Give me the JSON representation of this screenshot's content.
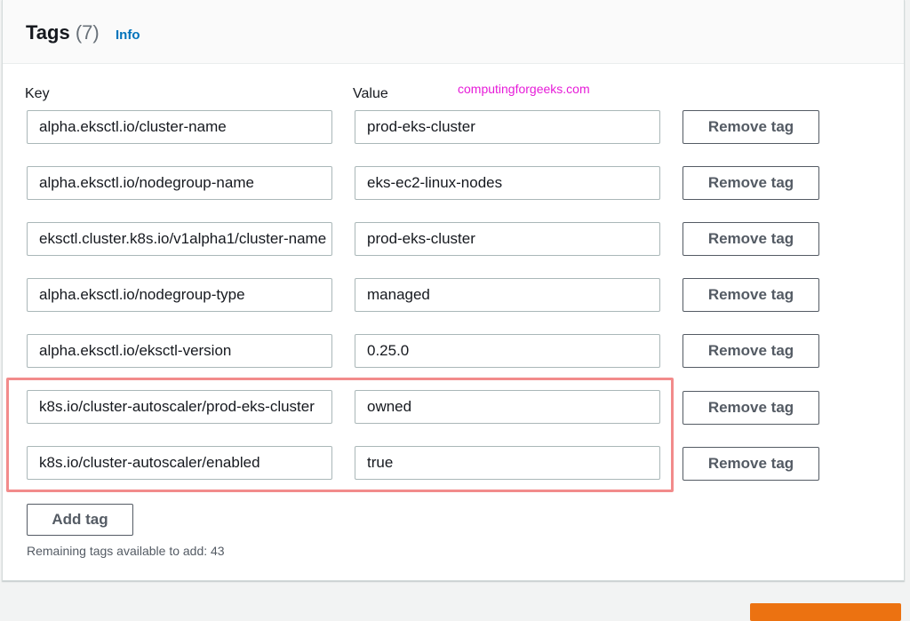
{
  "header": {
    "title": "Tags",
    "count": "(7)",
    "info_label": "Info"
  },
  "columns": {
    "key_label": "Key",
    "value_label": "Value"
  },
  "watermark": "computingforgeeks.com",
  "tags": [
    {
      "key": "alpha.eksctl.io/cluster-name",
      "value": "prod-eks-cluster"
    },
    {
      "key": "alpha.eksctl.io/nodegroup-name",
      "value": "eks-ec2-linux-nodes"
    },
    {
      "key": "eksctl.cluster.k8s.io/v1alpha1/cluster-name",
      "value": "prod-eks-cluster"
    },
    {
      "key": "alpha.eksctl.io/nodegroup-type",
      "value": "managed"
    },
    {
      "key": "alpha.eksctl.io/eksctl-version",
      "value": "0.25.0"
    },
    {
      "key": "k8s.io/cluster-autoscaler/prod-eks-cluster",
      "value": "owned"
    },
    {
      "key": "k8s.io/cluster-autoscaler/enabled",
      "value": "true"
    }
  ],
  "remove_label": "Remove tag",
  "add_label": "Add tag",
  "remaining_text": "Remaining tags available to add: 43",
  "colors": {
    "link": "#0073bb",
    "highlight": "#f28b8b",
    "primary_button": "#ec7211",
    "watermark": "#e61bd8"
  }
}
